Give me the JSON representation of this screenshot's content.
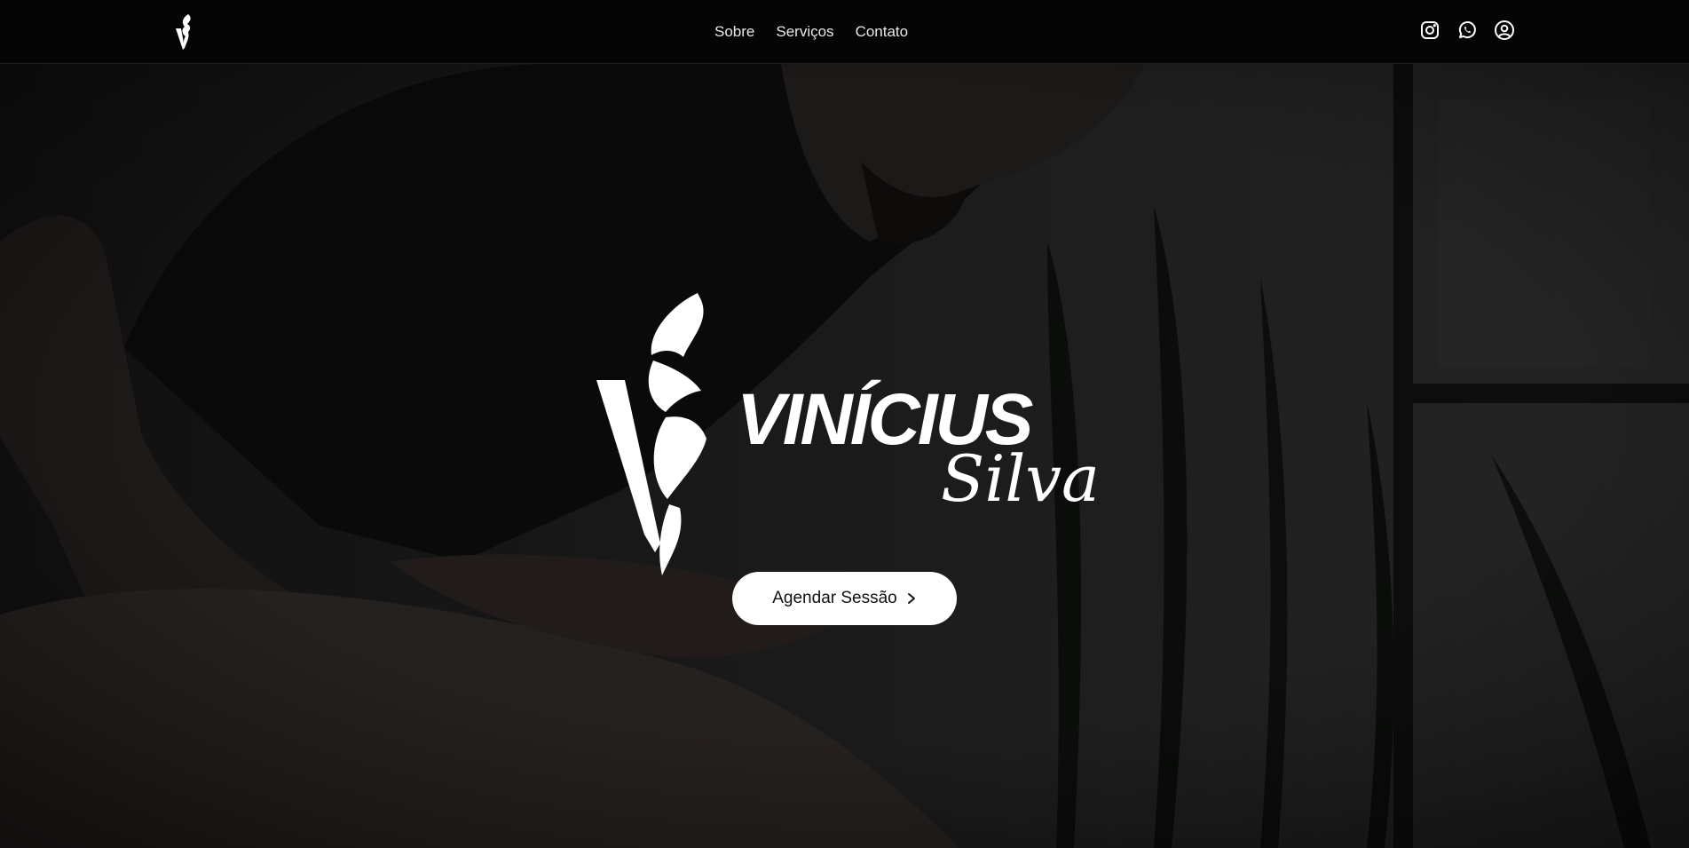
{
  "header": {
    "logo_icon": "feather-v-logo-icon",
    "nav": [
      {
        "label": "Sobre"
      },
      {
        "label": "Serviços"
      },
      {
        "label": "Contato"
      }
    ],
    "social_icons": [
      "instagram-icon",
      "whatsapp-icon",
      "user-account-icon"
    ]
  },
  "hero": {
    "logo_wordmark": "VINÍCIUS",
    "logo_script": "Silva",
    "cta_label": "Agendar Sessão",
    "cta_icon": "chevron-right-icon"
  },
  "colors": {
    "topbar_bg": "#050505",
    "text": "#ffffff",
    "button_bg": "#ffffff",
    "button_text": "#111111"
  }
}
